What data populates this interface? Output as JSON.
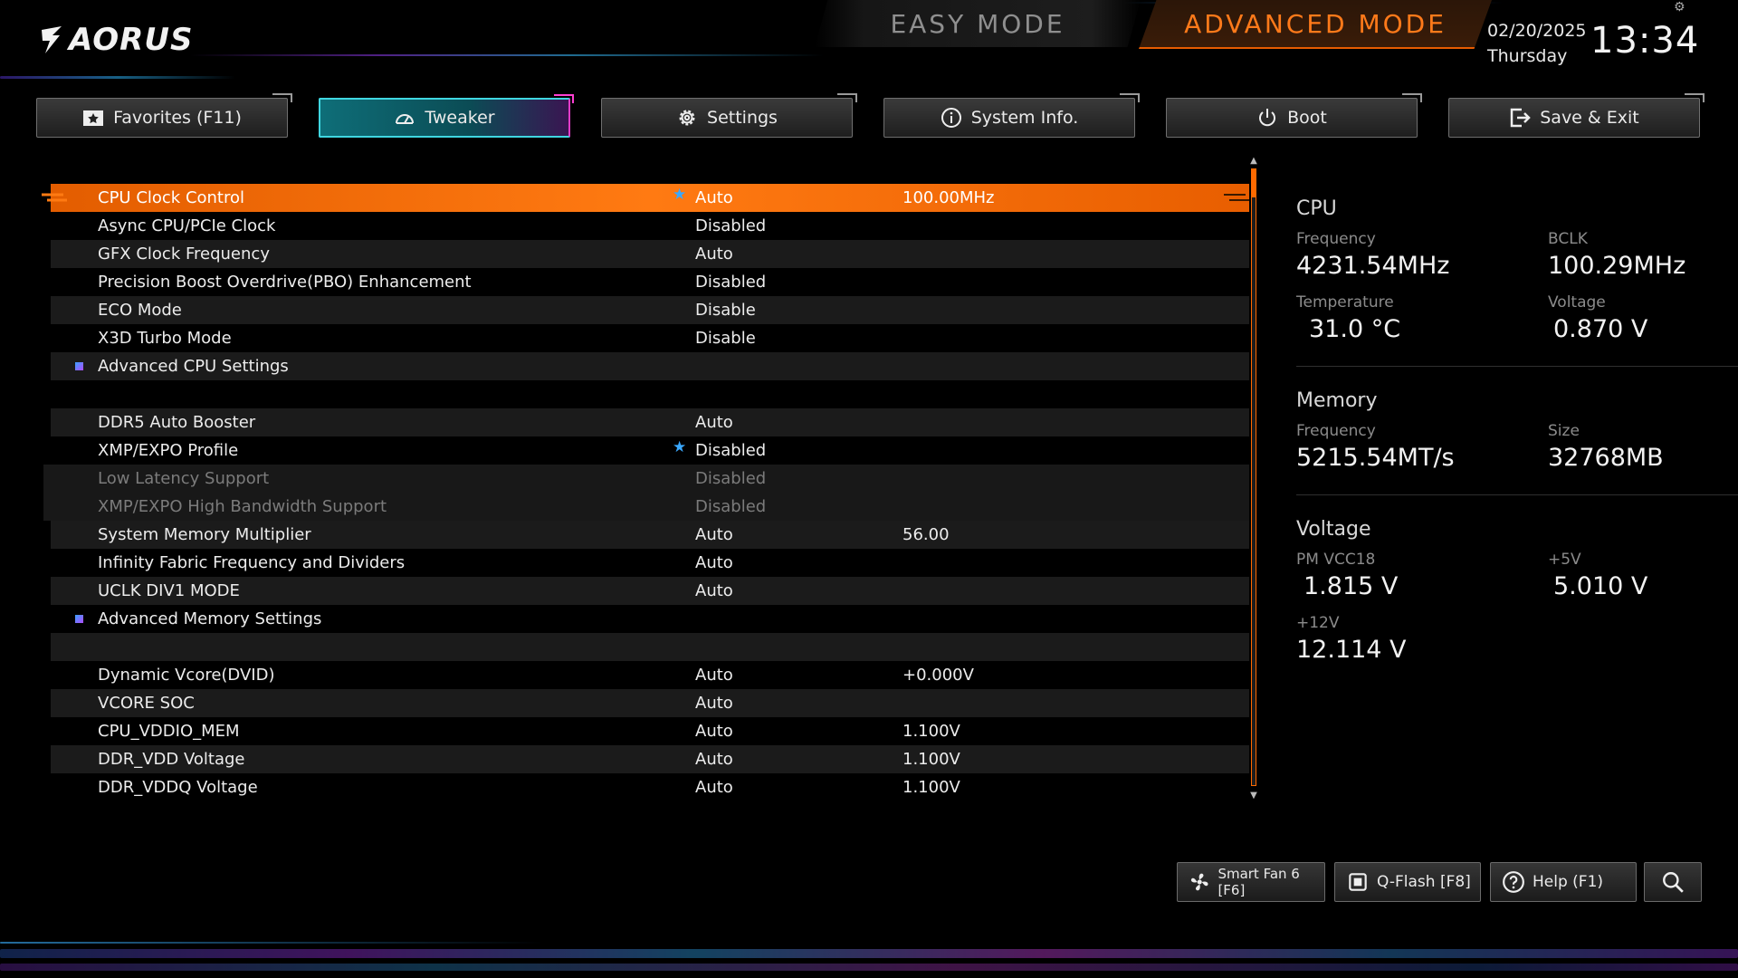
{
  "header": {
    "brand": "AORUS",
    "easy_mode": "EASY MODE",
    "advanced_mode": "ADVANCED MODE",
    "date": "02/20/2025",
    "day": "Thursday",
    "time": "13:34"
  },
  "tabs": [
    {
      "label": "Favorites (F11)",
      "icon": "star-folder-icon"
    },
    {
      "label": "Tweaker",
      "icon": "speedometer-icon",
      "active": true
    },
    {
      "label": "Settings",
      "icon": "gear-icon"
    },
    {
      "label": "System Info.",
      "icon": "info-icon"
    },
    {
      "label": "Boot",
      "icon": "power-icon"
    },
    {
      "label": "Save & Exit",
      "icon": "exit-icon"
    }
  ],
  "settings": [
    {
      "label": "CPU Clock Control",
      "value": "Auto",
      "value2": "100.00MHz",
      "star": true,
      "selected": true
    },
    {
      "label": "Async CPU/PCIe Clock",
      "value": "Disabled"
    },
    {
      "label": "GFX Clock Frequency",
      "value": "Auto"
    },
    {
      "label": "Precision Boost Overdrive(PBO) Enhancement",
      "value": "Disabled"
    },
    {
      "label": "ECO Mode",
      "value": "Disable"
    },
    {
      "label": "X3D Turbo Mode",
      "value": "Disable"
    },
    {
      "label": "Advanced CPU Settings",
      "submenu": true
    },
    {
      "label": "DDR5 Auto Booster",
      "value": "Auto"
    },
    {
      "label": "XMP/EXPO Profile",
      "value": "Disabled",
      "star": true
    },
    {
      "label": "Low Latency Support",
      "value": "Disabled",
      "greyed": true
    },
    {
      "label": "XMP/EXPO High Bandwidth Support",
      "value": "Disabled",
      "greyed": true
    },
    {
      "label": "System Memory Multiplier",
      "value": "Auto",
      "value2": "56.00"
    },
    {
      "label": "Infinity Fabric Frequency and Dividers",
      "value": "Auto"
    },
    {
      "label": "UCLK DIV1 MODE",
      "value": "Auto"
    },
    {
      "label": "Advanced Memory Settings",
      "submenu": true
    },
    {
      "label": "Dynamic Vcore(DVID)",
      "value": "Auto",
      "value2": "+0.000V"
    },
    {
      "label": "VCORE SOC",
      "value": "Auto"
    },
    {
      "label": "CPU_VDDIO_MEM",
      "value": "Auto",
      "value2": "1.100V"
    },
    {
      "label": "DDR_VDD Voltage",
      "value": "Auto",
      "value2": "1.100V"
    },
    {
      "label": "DDR_VDDQ Voltage",
      "value": "Auto",
      "value2": "1.100V"
    }
  ],
  "info": {
    "cpu": {
      "title": "CPU",
      "frequency_label": "Frequency",
      "frequency": "4231.54MHz",
      "bclk_label": "BCLK",
      "bclk": "100.29MHz",
      "temperature_label": "Temperature",
      "temperature": "31.0 °C",
      "voltage_label": "Voltage",
      "voltage": "0.870 V"
    },
    "memory": {
      "title": "Memory",
      "frequency_label": "Frequency",
      "frequency": "5215.54MT/s",
      "size_label": "Size",
      "size": "32768MB"
    },
    "voltage": {
      "title": "Voltage",
      "pm_vcc18_label": "PM VCC18",
      "pm_vcc18": "1.815 V",
      "p5v_label": "+5V",
      "p5v": "5.010 V",
      "p12v_label": "+12V",
      "p12v": "12.114 V"
    }
  },
  "bottom": {
    "smart_fan": "Smart Fan 6 [F6]",
    "qflash": "Q-Flash [F8]",
    "help": "Help (F1)"
  },
  "colors": {
    "accent": "#ff7a12",
    "active_tab": "#0e6e78",
    "star": "#3aa8ff"
  }
}
